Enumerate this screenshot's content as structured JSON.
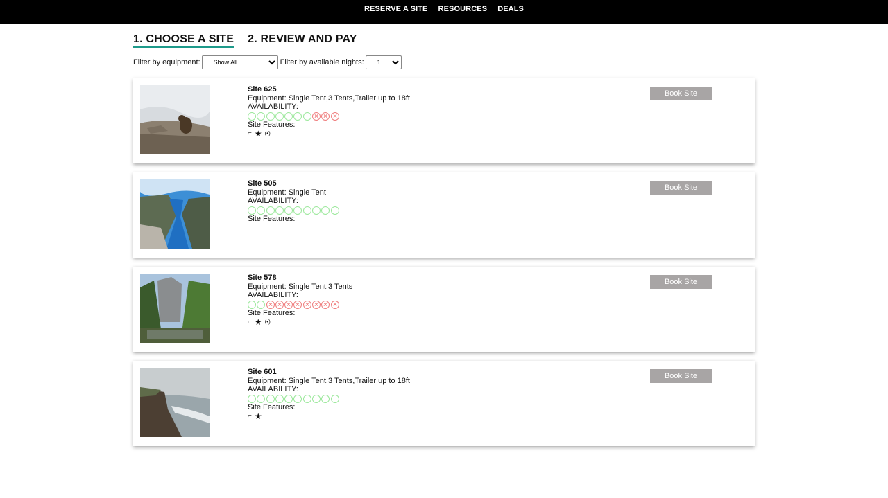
{
  "nav": {
    "items": [
      "RESERVE A SITE",
      "RESOURCES",
      "DEALS"
    ]
  },
  "steps": {
    "step1": "1. CHOOSE A SITE",
    "step2": "2. REVIEW AND PAY"
  },
  "filters": {
    "equipment_label": "Filter by equipment:",
    "equipment_value": "Show All",
    "nights_label": "Filter by available nights:",
    "nights_value": "1"
  },
  "colors": {
    "available": "#9be89b",
    "unavailable": "#ef7d7d",
    "step_underline": "#1d9a8a",
    "book_button": "#a8a5a5"
  },
  "availability_label": "AVAILABILITY:",
  "features_label": "Site Features:",
  "book_label": "Book Site",
  "sites": [
    {
      "title": "Site 625",
      "equipment": "Equipment: Single Tent,3 Tents,Trailer up to 18ft",
      "availability": [
        true,
        true,
        true,
        true,
        true,
        true,
        true,
        false,
        false,
        false
      ],
      "features": [
        "plug-icon",
        "star-icon",
        "wifi-icon"
      ],
      "image": "bear-on-rocks"
    },
    {
      "title": "Site 505",
      "equipment": "Equipment: Single Tent",
      "availability": [
        true,
        true,
        true,
        true,
        true,
        true,
        true,
        true,
        true,
        true
      ],
      "features": [],
      "image": "fjord"
    },
    {
      "title": "Site 578",
      "equipment": "Equipment: Single Tent,3 Tents",
      "availability": [
        true,
        true,
        false,
        false,
        false,
        false,
        false,
        false,
        false,
        false
      ],
      "features": [
        "plug-icon",
        "star-icon",
        "wifi-icon"
      ],
      "image": "valley-forest"
    },
    {
      "title": "Site 601",
      "equipment": "Equipment: Single Tent,3 Tents,Trailer up to 18ft",
      "availability": [
        true,
        true,
        true,
        true,
        true,
        true,
        true,
        true,
        true,
        true
      ],
      "features": [
        "plug-icon",
        "star-icon"
      ],
      "image": "coastline"
    }
  ]
}
